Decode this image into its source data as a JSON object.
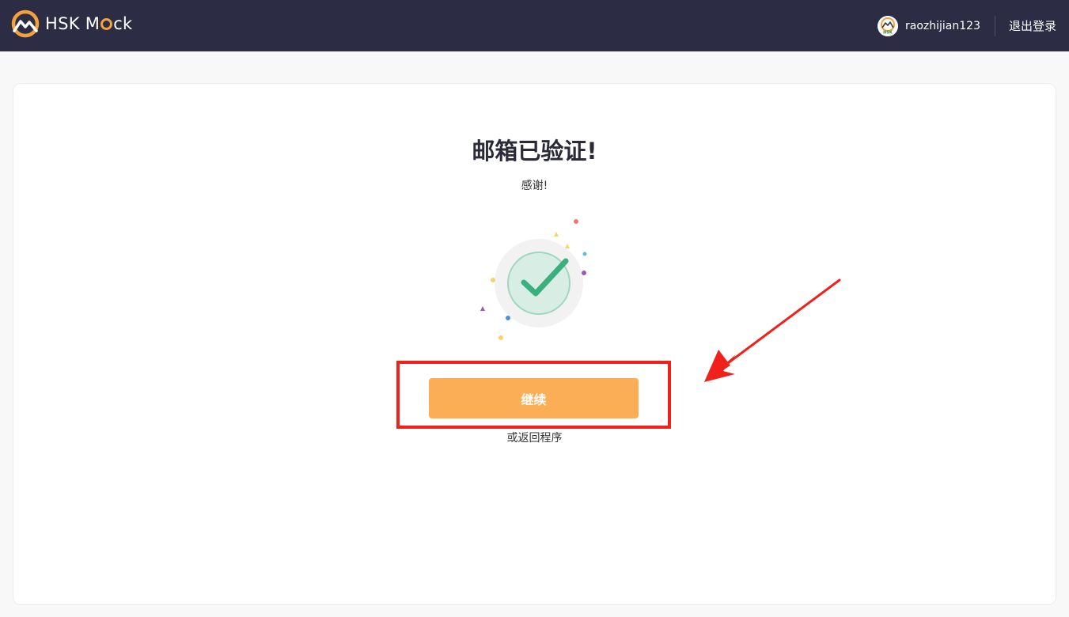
{
  "header": {
    "brand": "HSK M",
    "brand_suffix": "ck",
    "username": "raozhijian123",
    "logout_label": "退出登录",
    "avatar_badge": "HSK"
  },
  "main": {
    "title": "邮箱已验证!",
    "subtitle": "感谢!",
    "continue_label": "继续",
    "back_link": "或返回程序"
  },
  "colors": {
    "header_bg": "#2c2d45",
    "brand_accent": "#f2a23a",
    "button_bg": "#fbae55",
    "check_green": "#3bb07f",
    "annotation_red": "#f0211a"
  },
  "icons": {
    "logo": "mountain-logo-icon",
    "success": "checkmark-icon",
    "annotation": "arrow-annotation-icon"
  }
}
